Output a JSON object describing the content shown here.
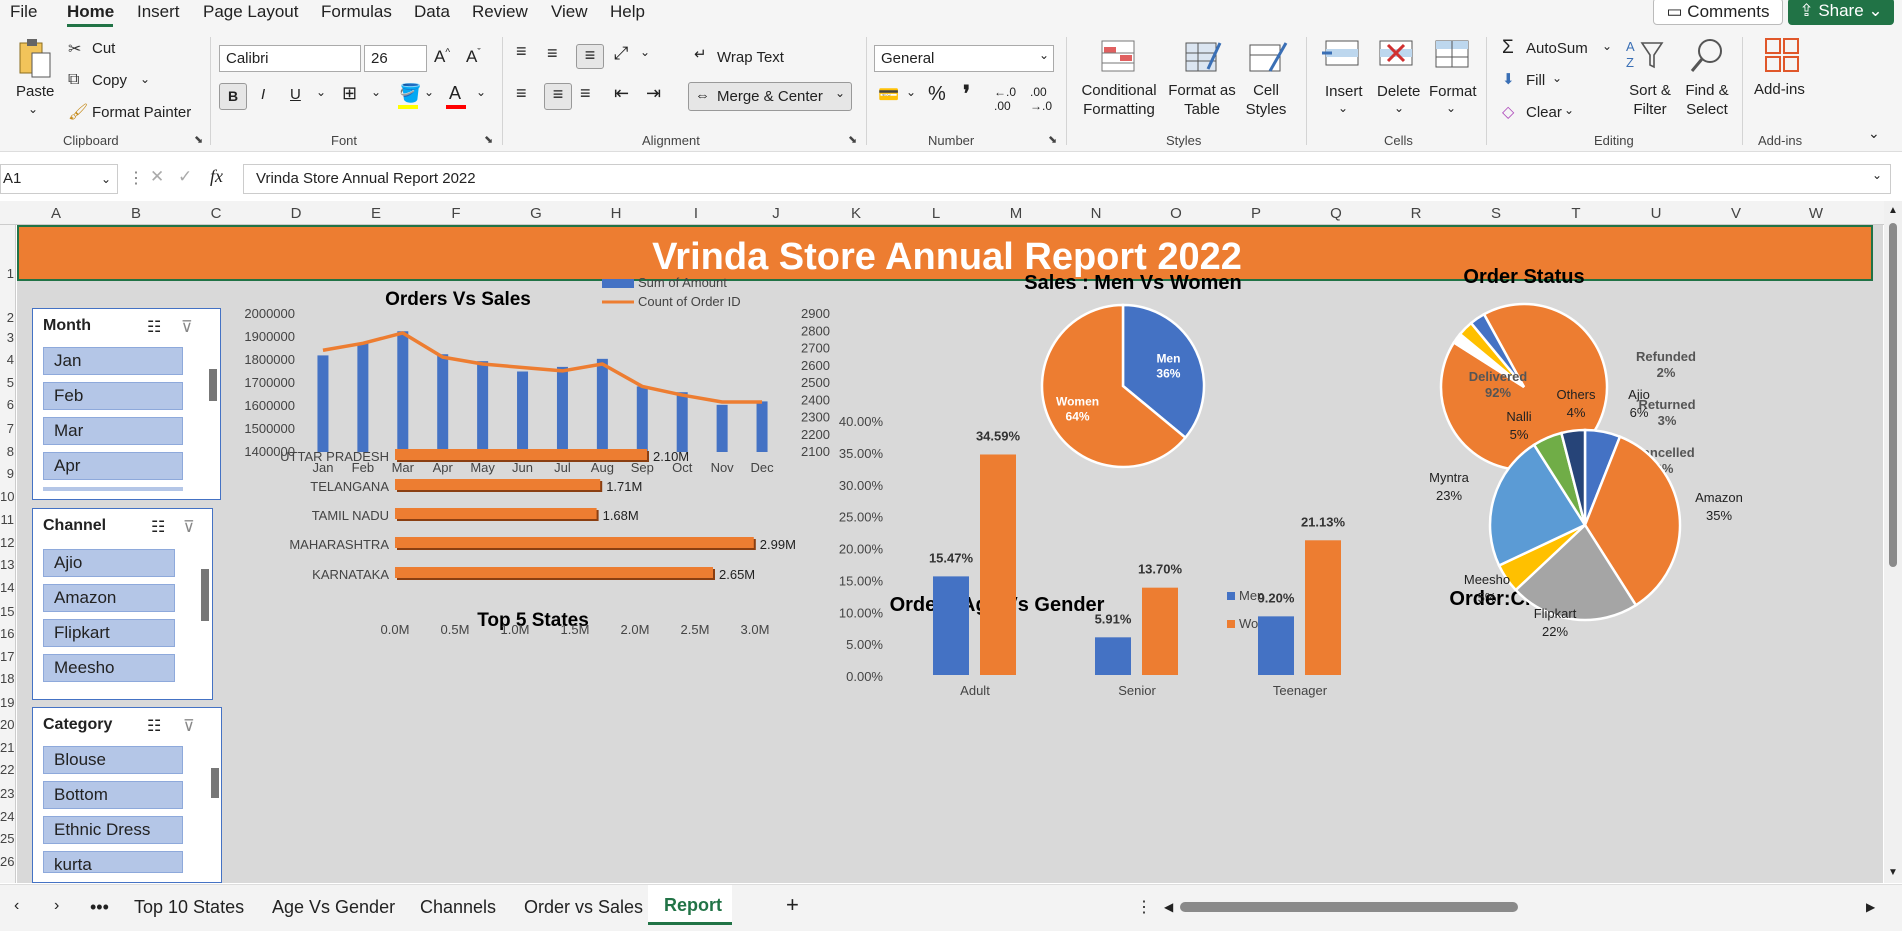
{
  "menu": {
    "items": [
      "File",
      "Home",
      "Insert",
      "Page Layout",
      "Formulas",
      "Data",
      "Review",
      "View",
      "Help"
    ],
    "active": "Home",
    "comments": "Comments",
    "share": "Share"
  },
  "ribbon": {
    "clipboard": {
      "paste": "Paste",
      "cut": "Cut",
      "copy": "Copy",
      "format_painter": "Format Painter",
      "label": "Clipboard"
    },
    "font": {
      "name": "Calibri",
      "size": "26",
      "label": "Font",
      "bold": "B",
      "italic": "I",
      "underline": "U"
    },
    "alignment": {
      "wrap": "Wrap Text",
      "merge": "Merge & Center",
      "label": "Alignment"
    },
    "number": {
      "format": "General",
      "percent": "%",
      "comma": "❜",
      "label": "Number"
    },
    "styles": {
      "conditional": "Conditional Formatting",
      "format_table": "Format as Table",
      "cell_styles": "Cell Styles",
      "label": "Styles"
    },
    "cells": {
      "insert": "Insert",
      "delete": "Delete",
      "format": "Format",
      "label": "Cells"
    },
    "editing": {
      "autosum": "AutoSum",
      "fill": "Fill",
      "clear": "Clear",
      "sort": "Sort & Filter",
      "find": "Find & Select",
      "label": "Editing"
    },
    "addins": {
      "addins": "Add-ins",
      "label": "Add-ins"
    }
  },
  "formula_bar": {
    "cell_ref": "A1",
    "fx": "fx",
    "value": "Vrinda Store Annual Report 2022"
  },
  "columns": [
    "A",
    "B",
    "C",
    "D",
    "E",
    "F",
    "G",
    "H",
    "I",
    "J",
    "K",
    "L",
    "M",
    "N",
    "O",
    "P",
    "Q",
    "R",
    "S",
    "T",
    "U",
    "V",
    "W"
  ],
  "rows": [
    "1",
    "2",
    "3",
    "4",
    "5",
    "6",
    "7",
    "8",
    "9",
    "10",
    "11",
    "12",
    "13",
    "14",
    "15",
    "16",
    "17",
    "18",
    "19",
    "20",
    "21",
    "22",
    "23",
    "24",
    "25",
    "26"
  ],
  "report_title": "Vrinda Store Annual Report 2022",
  "slicers": [
    {
      "title": "Month",
      "items": [
        "Jan",
        "Feb",
        "Mar",
        "Apr"
      ]
    },
    {
      "title": "Channel",
      "items": [
        "Ajio",
        "Amazon",
        "Flipkart",
        "Meesho"
      ]
    },
    {
      "title": "Category",
      "items": [
        "Blouse",
        "Bottom",
        "Ethnic Dress",
        "kurta"
      ]
    }
  ],
  "sheet_tabs": [
    "Top 10 States",
    "Age Vs Gender",
    "Channels",
    "Order vs Sales",
    "Report"
  ],
  "active_tab": "Report",
  "colors": {
    "blue": "#4472c4",
    "orange": "#ed7d31",
    "gray": "#a5a5a5",
    "yellow": "#ffc000",
    "lightblue": "#5b9bd5",
    "green": "#70ad47",
    "navy": "#264478",
    "excel_green": "#217346"
  },
  "chart_data": [
    {
      "type": "bar+line",
      "title": "Orders Vs Sales",
      "categories": [
        "Jan",
        "Feb",
        "Mar",
        "Apr",
        "May",
        "Jun",
        "Jul",
        "Aug",
        "Sep",
        "Oct",
        "Nov",
        "Dec"
      ],
      "series": [
        {
          "name": "Sum of Amount",
          "axis": "left",
          "values": [
            1820000,
            1875000,
            1925000,
            1825000,
            1795000,
            1750000,
            1770000,
            1805000,
            1685000,
            1660000,
            1605000,
            1620000
          ]
        },
        {
          "name": "Count of Order ID",
          "axis": "right",
          "values": [
            2690,
            2730,
            2790,
            2650,
            2610,
            2590,
            2570,
            2610,
            2480,
            2430,
            2390,
            2390
          ]
        }
      ],
      "y_left": {
        "ticks": [
          "2000000",
          "1900000",
          "1800000",
          "1700000",
          "1600000",
          "1500000",
          "1400000"
        ],
        "min": 1400000,
        "max": 2000000
      },
      "y_right": {
        "ticks": [
          "2900",
          "2800",
          "2700",
          "2600",
          "2500",
          "2400",
          "2300",
          "2200",
          "2100"
        ],
        "min": 2100,
        "max": 2900
      }
    },
    {
      "type": "pie",
      "title": "Sales : Men Vs Women",
      "slices": [
        {
          "name": "Men",
          "value": 36,
          "label": "36%"
        },
        {
          "name": "Women",
          "value": 64,
          "label": "64%"
        }
      ]
    },
    {
      "type": "pie",
      "title": "Order Status",
      "slices": [
        {
          "name": "Delivered",
          "value": 92,
          "label": "92%"
        },
        {
          "name": "Refunded",
          "value": 2,
          "label": "2%"
        },
        {
          "name": "Returned",
          "value": 3,
          "label": "3%"
        },
        {
          "name": "Cancelled",
          "value": 3,
          "label": "3%"
        }
      ]
    },
    {
      "type": "bar",
      "orientation": "horizontal",
      "title": "Top 5 States",
      "categories": [
        "UTTAR PRADESH",
        "TELANGANA",
        "TAMIL NADU",
        "MAHARASHTRA",
        "KARNATAKA"
      ],
      "values": [
        2.1,
        1.71,
        1.68,
        2.99,
        2.65
      ],
      "labels": [
        "2.10M",
        "1.71M",
        "1.68M",
        "2.99M",
        "2.65M"
      ],
      "x_ticks": [
        "0.0M",
        "0.5M",
        "1.0M",
        "1.5M",
        "2.0M",
        "2.5M",
        "3.0M"
      ],
      "xlim": [
        0,
        3.0
      ]
    },
    {
      "type": "bar",
      "title": "Order : Age Vs Gender",
      "categories": [
        "Adult",
        "Senior",
        "Teenager"
      ],
      "series": [
        {
          "name": "Men",
          "values": [
            15.47,
            5.91,
            9.2
          ],
          "labels": [
            "15.47%",
            "5.91%",
            "9.20%"
          ]
        },
        {
          "name": "Women",
          "values": [
            34.59,
            13.7,
            21.13
          ],
          "labels": [
            "34.59%",
            "13.70%",
            "21.13%"
          ]
        }
      ],
      "y_ticks": [
        "40.00%",
        "35.00%",
        "30.00%",
        "25.00%",
        "20.00%",
        "15.00%",
        "10.00%",
        "5.00%",
        "0.00%"
      ],
      "ylim": [
        0,
        40
      ]
    },
    {
      "type": "pie",
      "title": "Order:Channels",
      "slices": [
        {
          "name": "Ajio",
          "value": 6,
          "label": "6%"
        },
        {
          "name": "Amazon",
          "value": 35,
          "label": "35%"
        },
        {
          "name": "Flipkart",
          "value": 22,
          "label": "22%"
        },
        {
          "name": "Meesho",
          "value": 5,
          "label": "5%"
        },
        {
          "name": "Myntra",
          "value": 23,
          "label": "23%"
        },
        {
          "name": "Nalli",
          "value": 5,
          "label": "5%"
        },
        {
          "name": "Others",
          "value": 4,
          "label": "4%"
        }
      ]
    }
  ]
}
